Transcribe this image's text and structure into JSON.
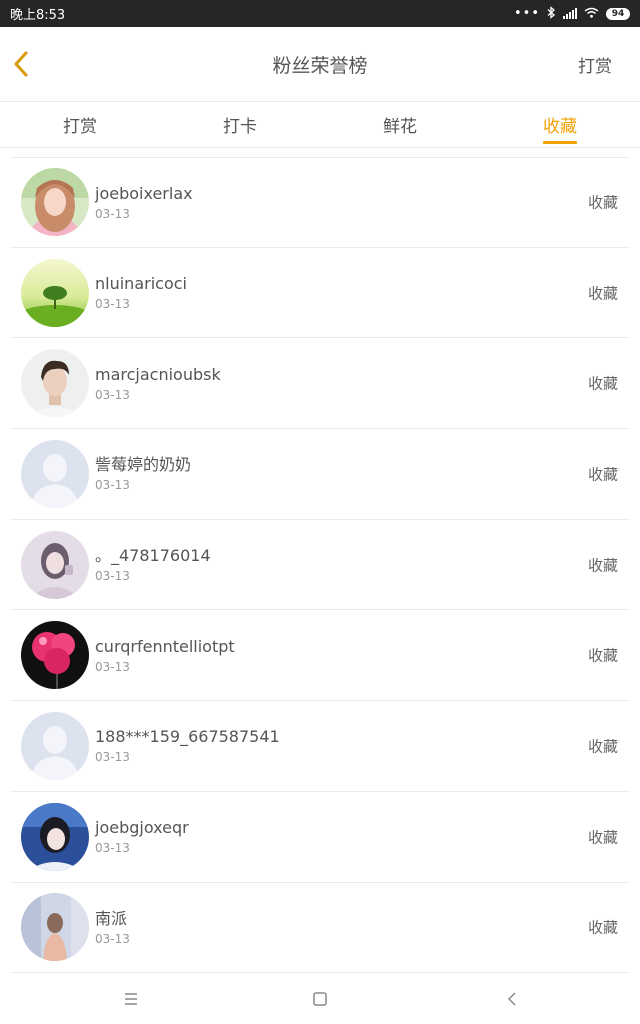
{
  "status_bar": {
    "time": "晚上8:53",
    "battery": "94"
  },
  "header": {
    "title": "粉丝荣誉榜",
    "right_action": "打赏"
  },
  "tabs": [
    {
      "label": "打赏",
      "active": false
    },
    {
      "label": "打卡",
      "active": false
    },
    {
      "label": "鲜花",
      "active": false
    },
    {
      "label": "收藏",
      "active": true
    }
  ],
  "list": [
    {
      "name": "joeboixerlax",
      "date": "03-13",
      "action": "收藏",
      "avatar": "girl-pink-photo"
    },
    {
      "name": "nluinaricoci",
      "date": "03-13",
      "action": "收藏",
      "avatar": "tree-landscape-photo"
    },
    {
      "name": "marcjacnioubsk",
      "date": "03-13",
      "action": "收藏",
      "avatar": "man-portrait-photo"
    },
    {
      "name": "訾莓婷的奶奶",
      "date": "03-13",
      "action": "收藏",
      "avatar": "default-avatar"
    },
    {
      "name": "。_478176014",
      "date": "03-13",
      "action": "收藏",
      "avatar": "girl-lilac-photo"
    },
    {
      "name": "curqrfenntelliotpt",
      "date": "03-13",
      "action": "收藏",
      "avatar": "pink-balloon-photo"
    },
    {
      "name": "188***159_667587541",
      "date": "03-13",
      "action": "收藏",
      "avatar": "default-avatar"
    },
    {
      "name": "joebgjoxeqr",
      "date": "03-13",
      "action": "收藏",
      "avatar": "girl-blue-photo"
    },
    {
      "name": "南派",
      "date": "03-13",
      "action": "收藏",
      "avatar": "girl-street-photo"
    }
  ],
  "colors": {
    "accent": "#f0a30a",
    "status_bar": "#262626",
    "divider": "#ececec"
  }
}
